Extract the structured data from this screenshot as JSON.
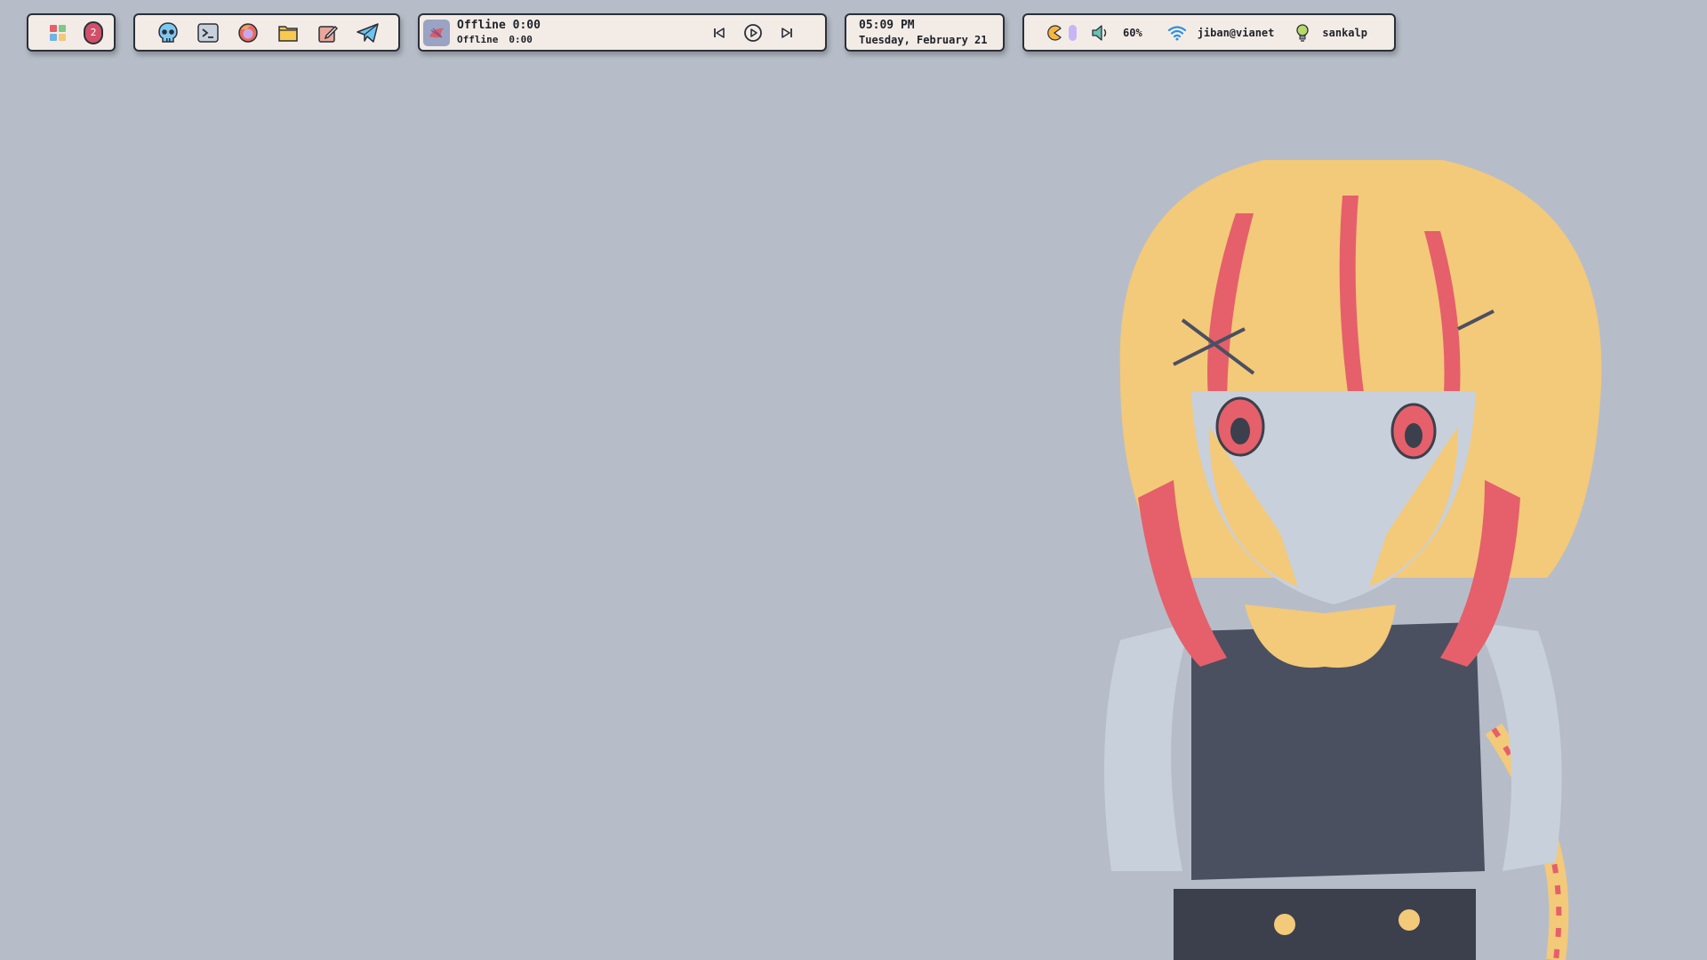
{
  "workspaces": {
    "badge": "2"
  },
  "launcher": {
    "icons": [
      "skull-icon",
      "terminal-icon",
      "firefox-icon",
      "folder-icon",
      "editor-icon",
      "telegram-icon"
    ]
  },
  "media": {
    "title": "Offline 0:00",
    "status": "Offline",
    "time": "0:00"
  },
  "clock": {
    "time": "05:09 PM",
    "date": "Tuesday, February 21"
  },
  "status": {
    "volume": "60%",
    "network": "jiban@vianet",
    "user": "sankalp"
  },
  "colors": {
    "bar_bg": "#f3ece6",
    "desktop_bg": "#b6bdc8",
    "badge": "#d0506a",
    "accent_yellow": "#f3c97a",
    "accent_red": "#e5606a"
  }
}
